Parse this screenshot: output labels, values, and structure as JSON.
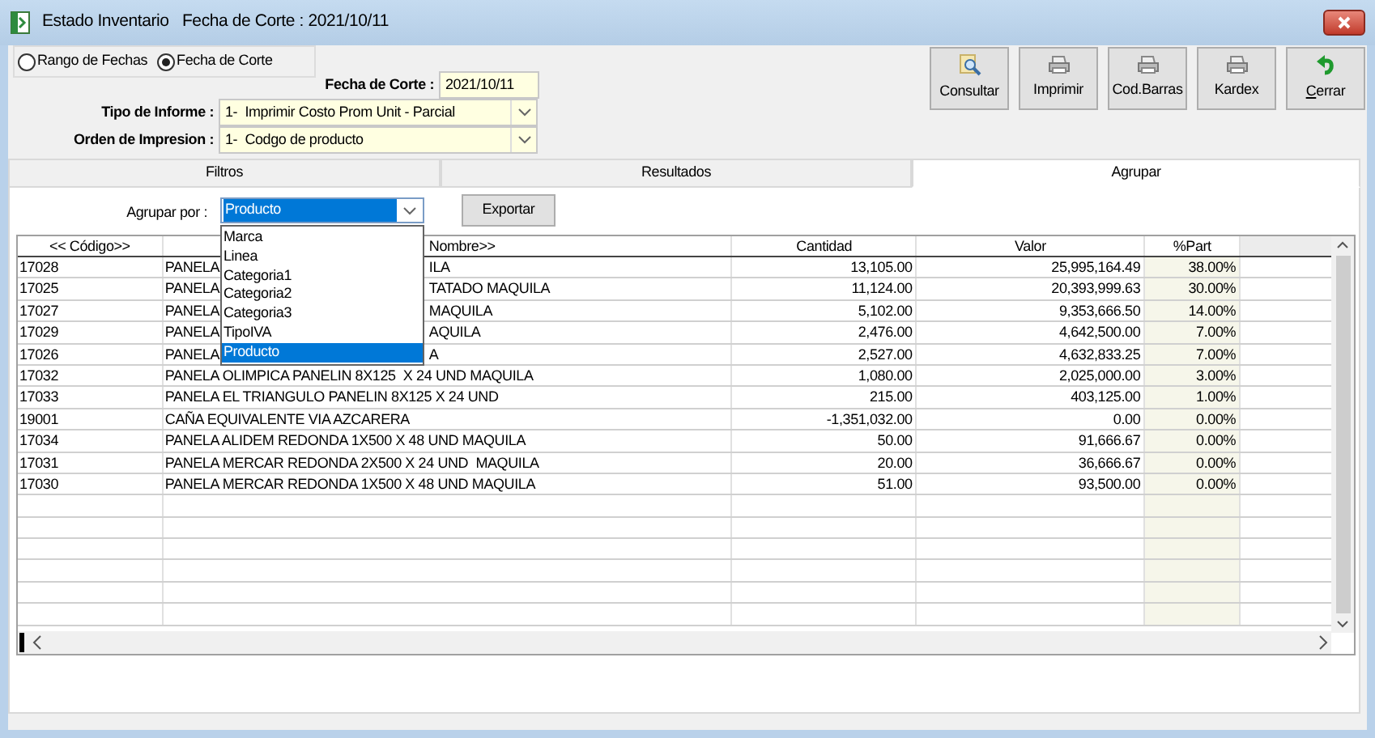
{
  "window": {
    "title": "Estado Inventario   Fecha de Corte : 2021/10/11"
  },
  "mode_options": [
    {
      "label": "Rango de Fechas",
      "selected": false
    },
    {
      "label": "Fecha de Corte",
      "selected": true
    }
  ],
  "fecha_corte": {
    "label": "Fecha de Corte :",
    "value": "2021/10/11"
  },
  "tipo_informe": {
    "label": "Tipo de Informe :",
    "value": "1-  Imprimir Costo Prom Unit - Parcial"
  },
  "orden_impresion": {
    "label": "Orden de Impresion :",
    "value": "1-  Codgo de producto"
  },
  "toolbar": [
    {
      "label": "Consultar",
      "kind": "search",
      "underline_first": false
    },
    {
      "label": "Imprimir",
      "kind": "print",
      "underline_first": false
    },
    {
      "label": "Cod.Barras",
      "kind": "print",
      "underline_first": false
    },
    {
      "label": "Kardex",
      "kind": "print",
      "underline_first": false
    },
    {
      "label": "Cerrar",
      "kind": "undo",
      "underline_first": true
    }
  ],
  "tabs": [
    {
      "label": "Filtros",
      "selected": false
    },
    {
      "label": "Resultados",
      "selected": false
    },
    {
      "label": "Agrupar",
      "selected": true
    }
  ],
  "group_by": {
    "label": "Agrupar por :",
    "value": "Producto",
    "expanded": true,
    "options": [
      {
        "label": "Marca",
        "selected": false
      },
      {
        "label": "Linea",
        "selected": false
      },
      {
        "label": "Categoria1",
        "selected": false
      },
      {
        "label": "Categoria2",
        "selected": false
      },
      {
        "label": "Categoria3",
        "selected": false
      },
      {
        "label": "TipoIVA",
        "selected": false
      },
      {
        "label": "Producto",
        "selected": true
      }
    ]
  },
  "export_button": "Exportar",
  "table": {
    "columns": [
      {
        "label": "<< Código>>",
        "kind": "plain"
      },
      {
        "label": "Nombre>>",
        "kind": "covered"
      },
      {
        "label": "Cantidad",
        "kind": "plain"
      },
      {
        "label": "Valor",
        "kind": "plain"
      },
      {
        "label": "%Part",
        "kind": "plain"
      }
    ],
    "rows": [
      {
        "code": "17028",
        "name": "PANELA",
        "name_tail": "ILA",
        "cantidad": "13,105.00",
        "valor": "25,995,164.49",
        "part": "38.00%"
      },
      {
        "code": "17025",
        "name": "PANELA",
        "name_tail": "TATADO MAQUILA",
        "cantidad": "11,124.00",
        "valor": "20,393,999.63",
        "part": "30.00%"
      },
      {
        "code": "17027",
        "name": "PANELA",
        "name_tail": "MAQUILA",
        "cantidad": "5,102.00",
        "valor": "9,353,666.50",
        "part": "14.00%"
      },
      {
        "code": "17029",
        "name": "PANELA",
        "name_tail": "AQUILA",
        "cantidad": "2,476.00",
        "valor": "4,642,500.00",
        "part": "7.00%"
      },
      {
        "code": "17026",
        "name": "PANELA",
        "name_tail": "A",
        "cantidad": "2,527.00",
        "valor": "4,632,833.25",
        "part": "7.00%"
      },
      {
        "code": "17032",
        "name": "PANELA OLIMPICA PANELIN 8X125  X 24 UND MAQUILA",
        "cantidad": "1,080.00",
        "valor": "2,025,000.00",
        "part": "3.00%"
      },
      {
        "code": "17033",
        "name": "PANELA EL TRIANGULO PANELIN 8X125 X 24 UND",
        "cantidad": "215.00",
        "valor": "403,125.00",
        "part": "1.00%"
      },
      {
        "code": "19001",
        "name": "CAÑA EQUIVALENTE VIA AZCARERA",
        "cantidad": "-1,351,032.00",
        "valor": "0.00",
        "part": "0.00%"
      },
      {
        "code": "17034",
        "name": "PANELA ALIDEM REDONDA 1X500 X 48 UND MAQUILA",
        "cantidad": "50.00",
        "valor": "91,666.67",
        "part": "0.00%"
      },
      {
        "code": "17031",
        "name": "PANELA MERCAR REDONDA 2X500 X 24 UND  MAQUILA",
        "cantidad": "20.00",
        "valor": "36,666.67",
        "part": "0.00%"
      },
      {
        "code": "17030",
        "name": "PANELA MERCAR REDONDA 1X500 X 48 UND MAQUILA",
        "cantidad": "51.00",
        "valor": "93,500.00",
        "part": "0.00%"
      }
    ]
  }
}
